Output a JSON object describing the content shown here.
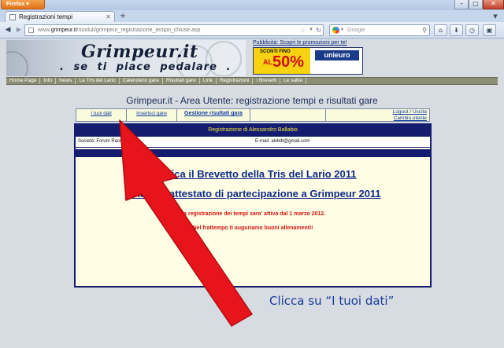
{
  "browser": {
    "app_button": "Firefox",
    "tab_title": "Registrazioni tempi",
    "new_tab": "+",
    "url_prefix": "www.",
    "url_domain": "grimpeur.it",
    "url_path": "/moduli/grimpeur_registrazione_tempo_chiuse.asp",
    "search_placeholder": "Google"
  },
  "site": {
    "logo": "Grimpeur.it",
    "tagline": ". se ti piace pedalare .",
    "ad_label": "Pubblicità: Scopri le promozioni per te!",
    "ad_small": "SCONTI FINO",
    "ad_al": "AL",
    "ad_percent": "50%",
    "ad_brand": "unieuro",
    "menu": [
      "Home Page",
      "Info",
      "News",
      "La Tris del Lario",
      "Calendario gare",
      "Risultati gare",
      "Link",
      "Registrazioni",
      "I Brevetti",
      "Le salite"
    ]
  },
  "user_area": {
    "title": "Grimpeur.it - Area Utente: registrazione tempi e risultati gare",
    "tab_my_data": "I tuoi dati",
    "tab_insert": "Inserisci gare",
    "tab_manage": "Gestione risultati gara",
    "logout": "Logout / Uscita",
    "change_user": "Cambio utente"
  },
  "panel": {
    "header": "Registrazione di Alessandro Ballabio",
    "team": "Società: Forum Racing Team",
    "email": "E-mail: alxblb@gmail.com",
    "link_brevetto": "Scarica il Brevetto della Tris del Lario 2011",
    "link_attestato": "Scarica l'attestato di partecipazione a Grimpeur 2011",
    "notice_1": "La registrazione dei tempi sara' attiva dal 1 marzo 2012.",
    "notice_2": "Nel frattempo ti auguriamo buoni allenamenti!"
  },
  "annotation": {
    "caption": "Clicca su “I tuoi dati”",
    "arrow_color": "#e8141c"
  }
}
